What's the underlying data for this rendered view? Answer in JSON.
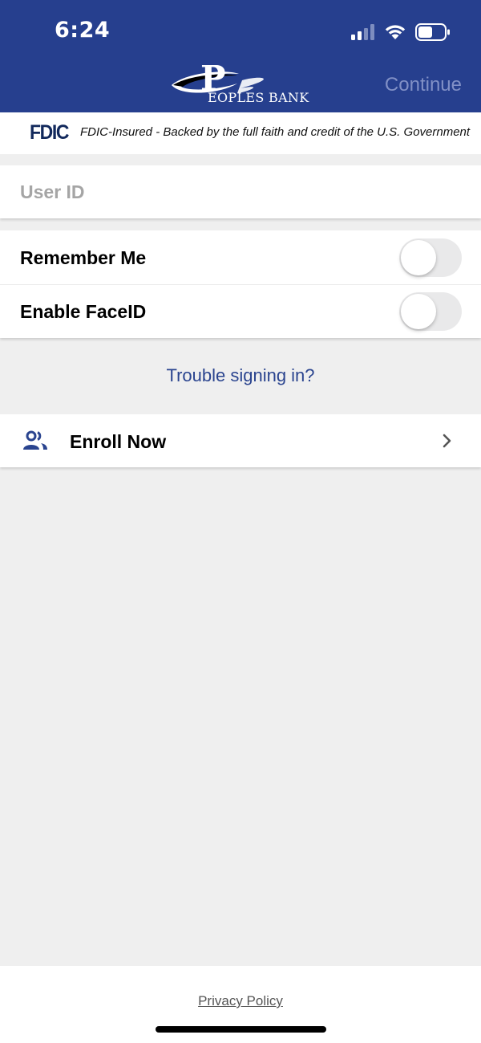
{
  "status_bar": {
    "time": "6:24"
  },
  "header": {
    "logo_text": "EOPLES BANK",
    "continue_label": "Continue"
  },
  "fdic": {
    "logo": "FDIC",
    "text": "FDIC-Insured - Backed by the full faith and credit of the U.S. Government"
  },
  "login": {
    "userid_placeholder": "User ID",
    "userid_value": ""
  },
  "toggles": [
    {
      "label": "Remember Me",
      "on": false
    },
    {
      "label": "Enable FaceID",
      "on": false
    }
  ],
  "trouble_label": "Trouble signing in?",
  "enroll": {
    "label": "Enroll Now",
    "icon": "people-icon"
  },
  "footer": {
    "privacy_label": "Privacy Policy"
  },
  "colors": {
    "header_bg": "#263f8e",
    "continue_text": "#8190c6",
    "link_blue": "#2a448f",
    "fdic_navy": "#12295c",
    "page_bg": "#efefef"
  }
}
